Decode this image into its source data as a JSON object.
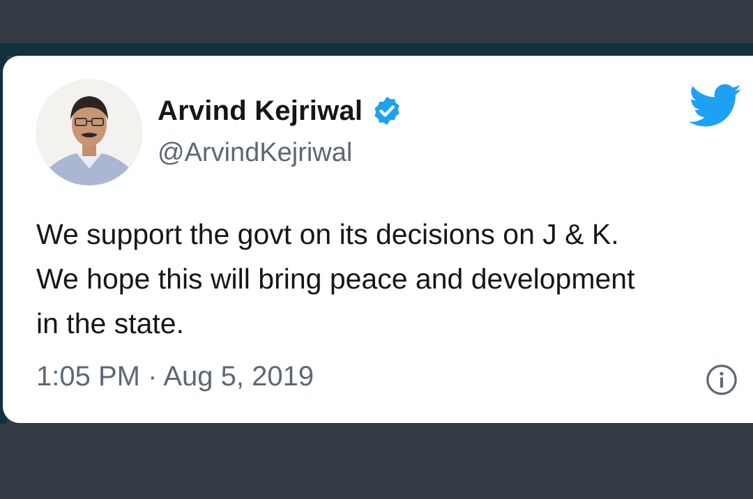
{
  "tweet": {
    "display_name": "Arvind Kejriwal",
    "handle": "@ArvindKejriwal",
    "verified": true,
    "body_lines": [
      "We support the govt on its decisions on J & K.",
      "We hope this will bring peace and development",
      "in the state."
    ],
    "time": "1:05 PM",
    "separator": "·",
    "date": "Aug 5, 2019"
  },
  "icons": {
    "verified": "verified-badge-icon",
    "brand": "twitter-bird-icon",
    "info": "info-icon",
    "avatar": "profile-photo"
  },
  "colors": {
    "twitter_blue": "#1da1f2",
    "text_primary": "#14171a",
    "text_secondary": "#5b6873",
    "card_background": "#ffffff",
    "page_background": "#343a43"
  }
}
